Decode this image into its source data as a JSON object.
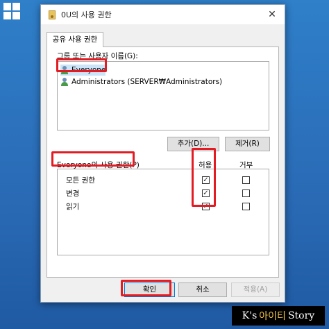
{
  "window_title": "0U의 사용 권한",
  "tab_label": "공유 사용 권한",
  "group_label": "그룹 또는 사용자 이름(G):",
  "users": [
    "Everyone",
    "Administrators (SERVER₩Administrators)"
  ],
  "add_button": "추가(D)...",
  "remove_button": "제거(R)",
  "permissions_label": "Everyone의 사용 권한(P)",
  "allow_header": "허용",
  "deny_header": "거부",
  "permissions": [
    {
      "name": "모든 권한",
      "allow": true,
      "deny": false
    },
    {
      "name": "변경",
      "allow": true,
      "deny": false
    },
    {
      "name": "읽기",
      "allow": true,
      "deny": false
    }
  ],
  "ok_button": "확인",
  "cancel_button": "취소",
  "apply_button": "적용(A)",
  "watermark": {
    "part1": "K's",
    "part2": "아이티",
    "part3": "Story"
  },
  "colors": {
    "highlight": "#e31b23",
    "desktop": "#2a6fb8",
    "check": "#333333"
  }
}
